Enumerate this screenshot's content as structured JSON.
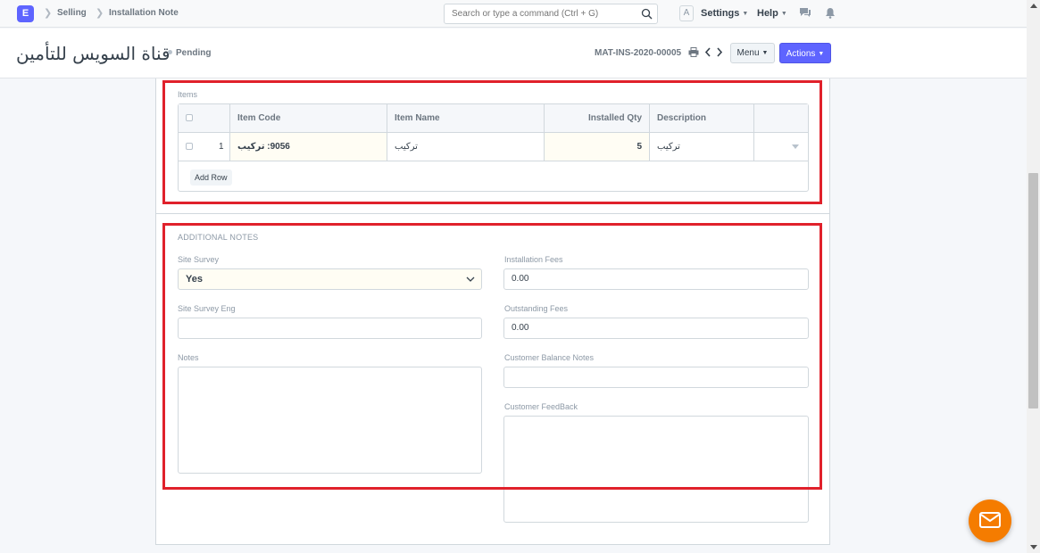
{
  "navbar": {
    "logo_letter": "E",
    "breadcrumbs": [
      "Selling",
      "Installation Note"
    ],
    "search_placeholder": "Search or type a command (Ctrl + G)",
    "avatar_letter": "A",
    "settings_label": "Settings",
    "help_label": "Help"
  },
  "page": {
    "title": "قناة السويس للتأمين",
    "status": "Pending",
    "doc_id": "MAT-INS-2020-00005",
    "menu_label": "Menu",
    "actions_label": "Actions"
  },
  "items": {
    "label": "Items",
    "columns": [
      "Item Code",
      "Item Name",
      "Installed Qty",
      "Description"
    ],
    "rows": [
      {
        "idx": "1",
        "item_code": "9056: تركيب",
        "item_name": "تركيب",
        "installed_qty": "5",
        "description": "تركيب"
      }
    ],
    "add_row_label": "Add Row"
  },
  "additional_notes": {
    "section_title": "ADDITIONAL NOTES",
    "site_survey_label": "Site Survey",
    "site_survey_value": "Yes",
    "site_survey_eng_label": "Site Survey Eng",
    "site_survey_eng_value": "",
    "notes_label": "Notes",
    "installation_fees_label": "Installation Fees",
    "installation_fees_value": "0.00",
    "outstanding_fees_label": "Outstanding Fees",
    "outstanding_fees_value": "0.00",
    "customer_balance_notes_label": "Customer Balance Notes",
    "customer_balance_notes_value": "",
    "customer_feedback_label": "Customer FeedBack"
  },
  "colors": {
    "primary": "#5e64ff",
    "annotation": "#e0212b",
    "chat": "#f57c00"
  },
  "icons": [
    "search-icon",
    "printer-icon",
    "chevron-left-icon",
    "chevron-right-icon",
    "comment-icon",
    "bell-icon",
    "chevron-down-icon",
    "mail-icon"
  ]
}
